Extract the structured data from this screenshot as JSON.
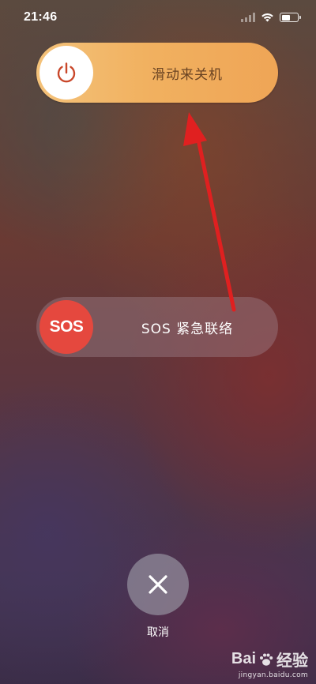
{
  "status_bar": {
    "time": "21:46",
    "icons": [
      "cellular-signal-icon",
      "wifi-icon",
      "battery-icon"
    ]
  },
  "power_slider": {
    "label": "滑动来关机",
    "icon": "power-icon",
    "colors": {
      "track": "#f1b160",
      "knob": "#ffffff",
      "icon": "#c9472a"
    }
  },
  "sos_slider": {
    "knob_text": "SOS",
    "label": "SOS 紧急联络",
    "colors": {
      "knob": "#e5483e"
    }
  },
  "cancel": {
    "label": "取消",
    "icon": "close-icon"
  },
  "annotation": {
    "icon": "red-arrow",
    "color": "#e02020"
  },
  "watermark": {
    "brand_left": "Bai",
    "brand_right": "经验",
    "url": "jingyan.baidu.com",
    "icon": "paw-icon"
  }
}
